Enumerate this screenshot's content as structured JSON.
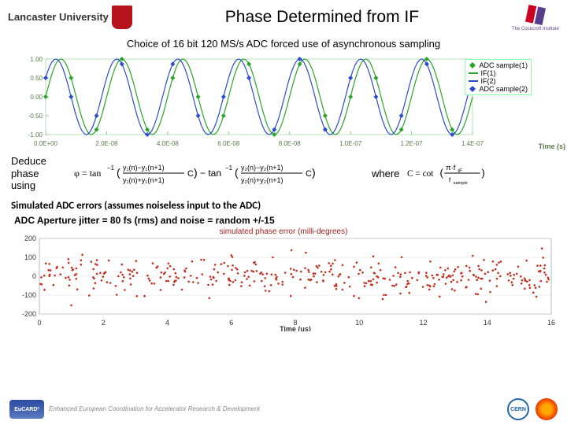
{
  "header": {
    "uni_name": "Lancaster\nUniversity",
    "title": "Phase Determined from IF",
    "ci_name": "The Cockcroft Institute"
  },
  "subtitle": "Choice of 16 bit 120 MS/s ADC forced use of asynchronous sampling",
  "chart_data": [
    {
      "type": "line",
      "title": "",
      "xlabel": "Time (s)",
      "ylabel": "",
      "xlim": [
        0,
        1.4e-07
      ],
      "ylim": [
        -1.0,
        1.0
      ],
      "xticks": [
        "0.0E+00",
        "2.0E-08",
        "4.0E-08",
        "6.0E-08",
        "8.0E-08",
        "1.0E-07",
        "1.2E-07",
        "1.4E-07"
      ],
      "yticks": [
        "-1.00",
        "-0.50",
        "0.00",
        "0.50",
        "1.00"
      ],
      "series": [
        {
          "name": "IF(1)",
          "color": "#2aa52a",
          "style": "line",
          "freq_hz": 50000000.0,
          "amp": 1.0,
          "phase_deg": 0
        },
        {
          "name": "IF(2)",
          "color": "#2a4ad0",
          "style": "line",
          "freq_hz": 50000000.0,
          "amp": 1.0,
          "phase_deg": 30
        },
        {
          "name": "ADC sample(1)",
          "color": "#2aa52a",
          "style": "points",
          "marker": "diamond",
          "sample_rate_hz": 120000000.0,
          "source": "IF(1)"
        },
        {
          "name": "ADC sample(2)",
          "color": "#2a4ad0",
          "style": "points",
          "marker": "diamond",
          "sample_rate_hz": 120000000.0,
          "source": "IF(2)"
        }
      ],
      "legend_order": [
        "ADC sample(1)",
        "IF(1)",
        "IF(2)",
        "ADC sample(2)"
      ]
    },
    {
      "type": "scatter",
      "title": "simulated phase error (milli-degrees)",
      "xlabel": "Time (us)",
      "ylabel": "",
      "xlim": [
        0,
        16
      ],
      "ylim": [
        -200,
        200
      ],
      "xticks": [
        "0",
        "2",
        "4",
        "6",
        "8",
        "10",
        "12",
        "14",
        "16"
      ],
      "yticks": [
        "-200",
        "-100",
        "0",
        "100",
        "200"
      ],
      "series": [
        {
          "name": "phase error",
          "color": "#c03020",
          "style": "points",
          "n_points": 400,
          "distribution": "random_uniform_x_gaussian_y",
          "y_mean": 0,
          "y_sigma": 50
        }
      ]
    }
  ],
  "formula": {
    "deduce_label": "Deduce phase using",
    "phi_tex": "φ = tan⁻¹( (y₁(n)−y₁(n+1))/(y₁(n)+y₁(n+1)) · C ) − tan⁻¹( (y₂(n)−y₂(n+1))/(y₂(n)+y₂(n+1)) · C )",
    "where_label": "where",
    "C_tex": "C = cot( π · f_IF / f_sample )"
  },
  "sim_title": "Simulated ADC errors (assumes noiseless input to the ADC)",
  "jitter_line": "ADC Aperture jitter = 80 fs (rms)  and noise = random  +/-15",
  "footer": {
    "eucard_logo": "EuCARD²",
    "eucard_tag": "Enhanced European Coordination for Accelerator\nResearch & Development",
    "cern": "CERN",
    "clic": "CLIC"
  }
}
